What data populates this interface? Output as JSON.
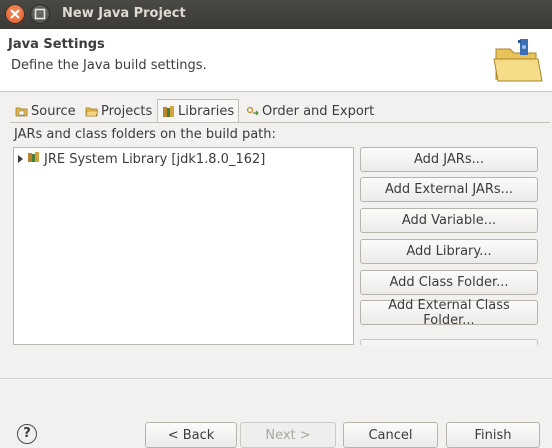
{
  "window": {
    "title": "New Java Project",
    "close_icon": "close-icon",
    "maximize_icon": "maximize-icon"
  },
  "header": {
    "title": "Java Settings",
    "description": "Define the Java build settings.",
    "icon": "java-project-folder-icon"
  },
  "tabs": [
    {
      "label": "Source",
      "icon": "source-folder-icon",
      "active": false
    },
    {
      "label": "Projects",
      "icon": "projects-icon",
      "active": false
    },
    {
      "label": "Libraries",
      "icon": "libraries-icon",
      "active": true
    },
    {
      "label": "Order and Export",
      "icon": "order-export-icon",
      "active": false
    }
  ],
  "libraries": {
    "caption": "JARs and class folders on the build path:",
    "tree_items": [
      {
        "label": "JRE System Library [jdk1.8.0_162]",
        "icon": "library-icon",
        "expanded": false
      }
    ],
    "buttons": [
      {
        "label": "Add JARs..."
      },
      {
        "label": "Add External JARs..."
      },
      {
        "label": "Add Variable..."
      },
      {
        "label": "Add Library..."
      },
      {
        "label": "Add Class Folder..."
      },
      {
        "label": "Add External Class Folder..."
      }
    ]
  },
  "footer": {
    "help_label": "?",
    "buttons": [
      {
        "label": "< Back",
        "enabled": true
      },
      {
        "label": "Next >",
        "enabled": false
      },
      {
        "label": "Cancel",
        "enabled": true
      },
      {
        "label": "Finish",
        "enabled": true
      }
    ]
  },
  "colors": {
    "titlebar": "#3c3b37",
    "close_button": "#e05a26",
    "dialog_bg": "#f2f1f0"
  }
}
